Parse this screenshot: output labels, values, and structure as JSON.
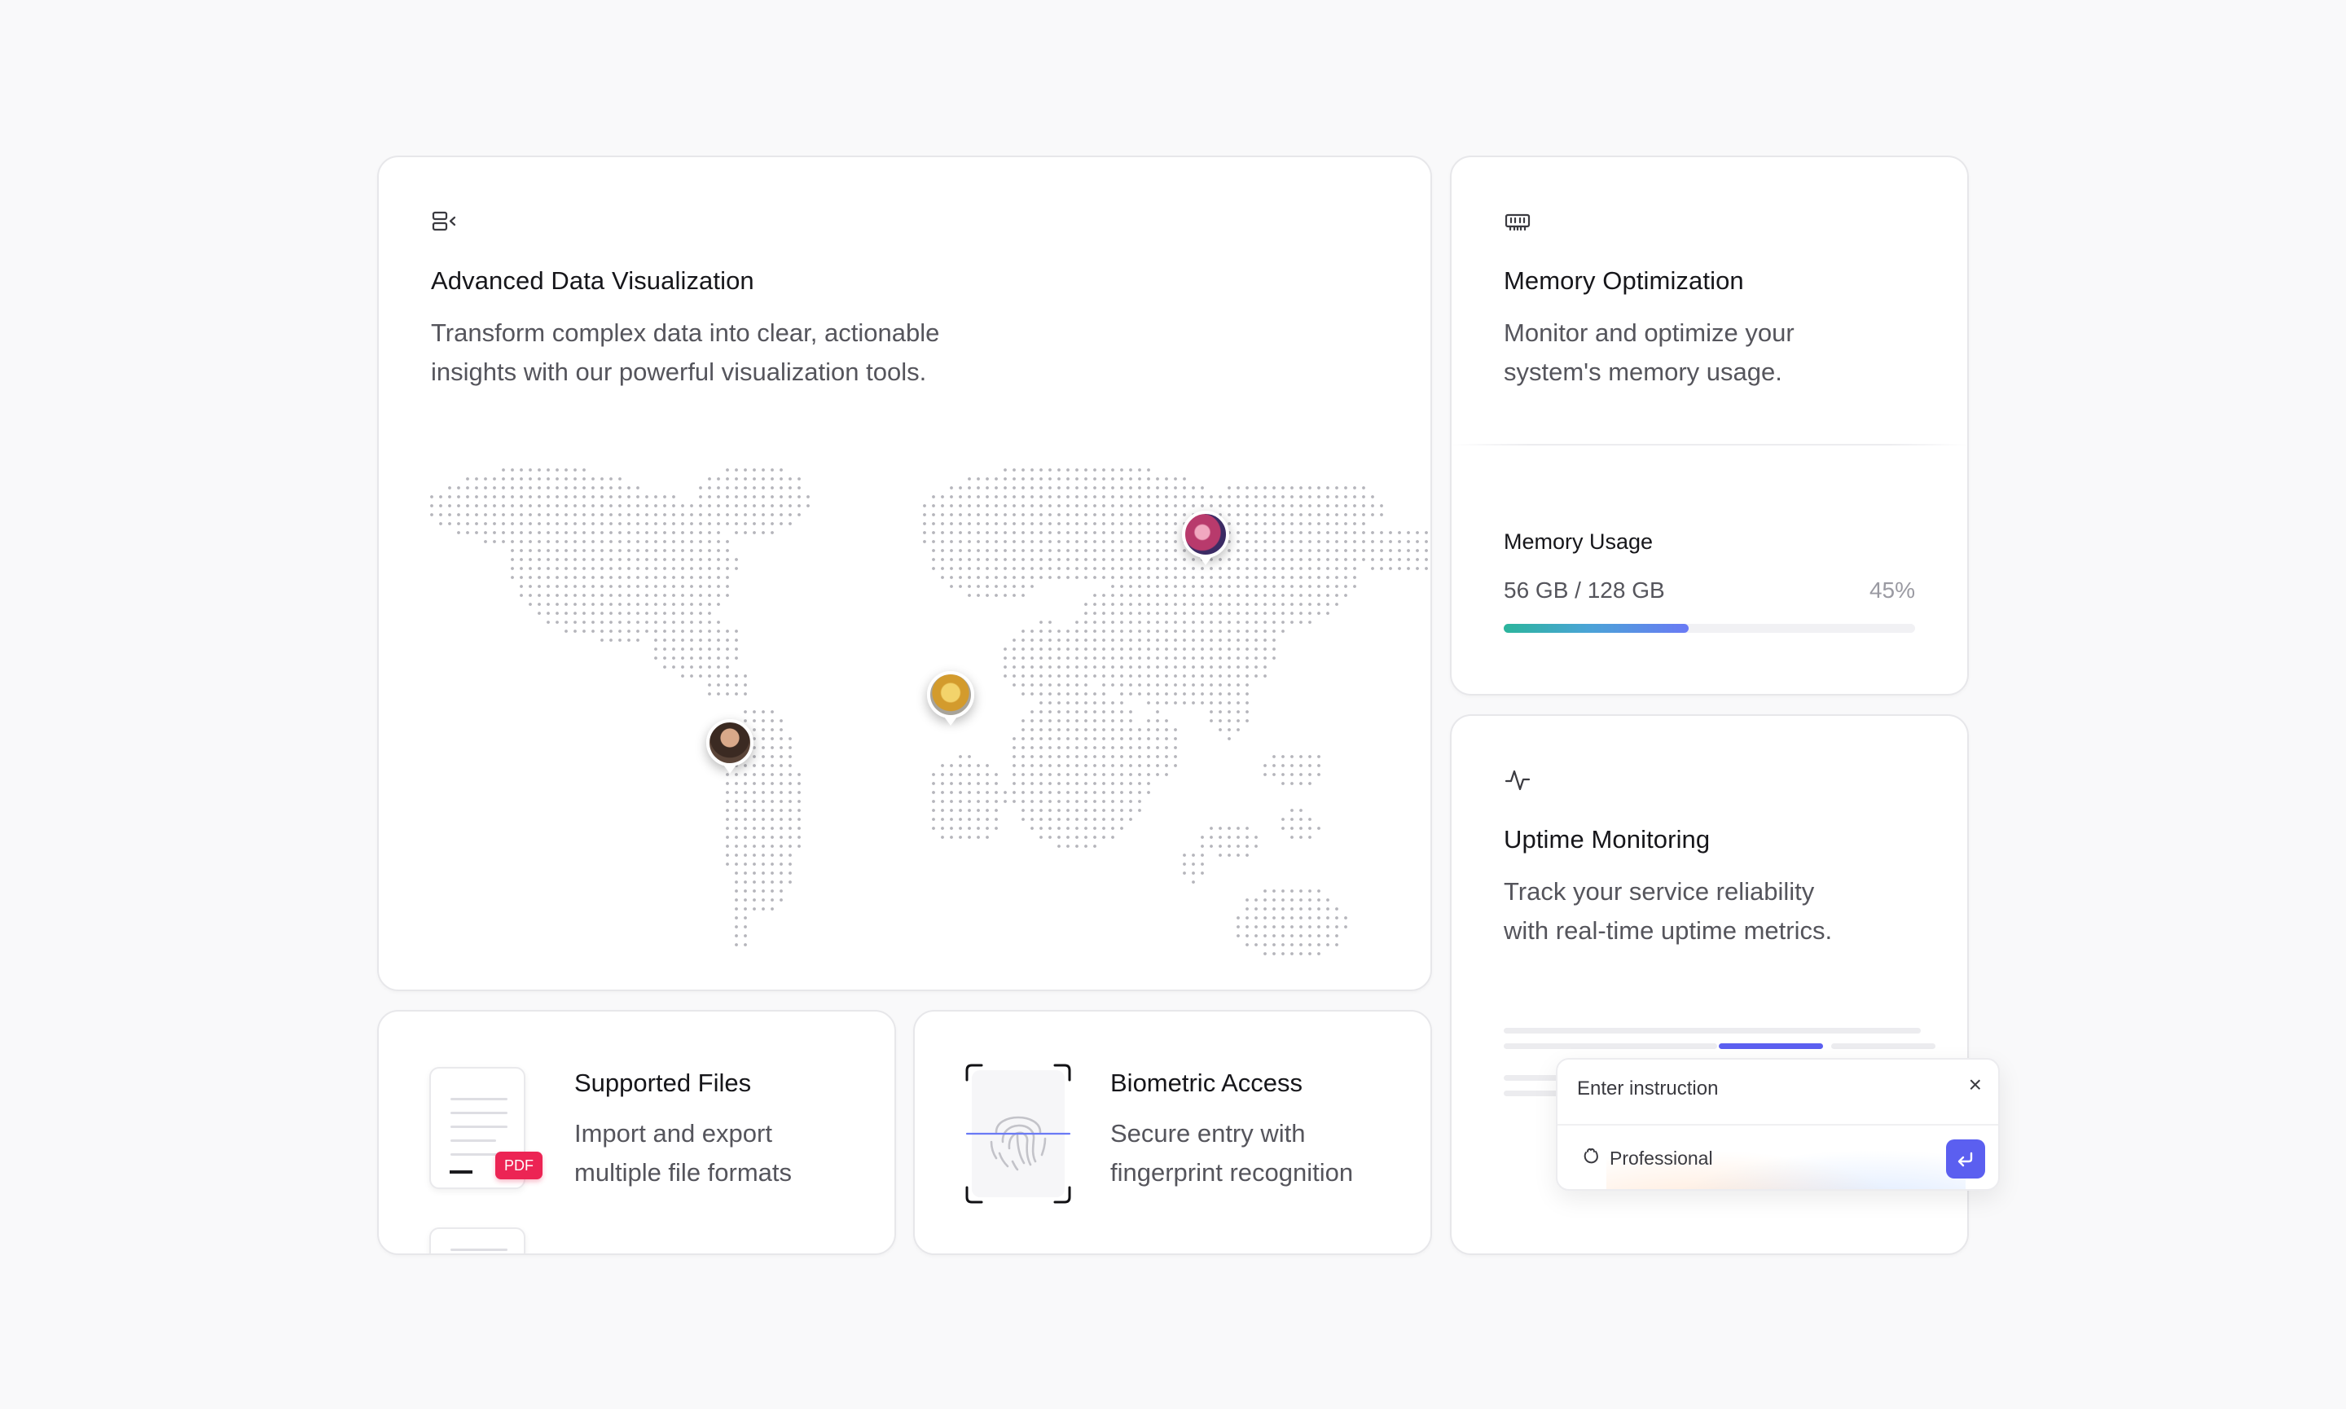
{
  "visualization": {
    "title": "Advanced Data Visualization",
    "description_line1": "Transform complex data into clear, actionable",
    "description_line2": "insights with our powerful visualization tools.",
    "icon": "columns-chevron-icon",
    "pins": [
      "avatar-south-america",
      "avatar-africa",
      "avatar-asia"
    ]
  },
  "memory": {
    "title": "Memory Optimization",
    "description_line1": "Monitor and optimize your",
    "description_line2": "system's memory usage.",
    "icon": "memory-chip-icon",
    "usage_label": "Memory Usage",
    "usage_value": "56 GB / 128 GB",
    "usage_percent_text": "45%",
    "usage_fraction": 0.45
  },
  "uptime": {
    "title": "Uptime Monitoring",
    "description_line1": "Track your service reliability",
    "description_line2": "with real-time uptime metrics.",
    "icon": "activity-icon",
    "popup": {
      "placeholder": "Enter instruction",
      "tone": "Professional",
      "close_symbol": "×"
    }
  },
  "files": {
    "title": "Supported Files",
    "description_line1": "Import and export",
    "description_line2": "multiple file formats",
    "badge": "PDF"
  },
  "biometric": {
    "title": "Biometric Access",
    "description_line1": "Secure entry with",
    "description_line2": "fingerprint recognition"
  },
  "colors": {
    "accent": "#5b5ff0",
    "progress_start": "#2bb59c",
    "progress_end": "#6a7af5",
    "pdf_badge": "#ec2454",
    "map_dot": "#b5b5bb"
  }
}
